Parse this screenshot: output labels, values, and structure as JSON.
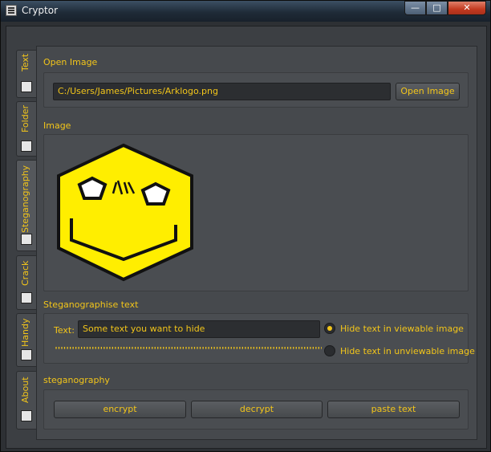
{
  "window": {
    "title": "Cryptor",
    "min_glyph": "—",
    "max_glyph": "□",
    "close_glyph": "✕"
  },
  "tabs": [
    {
      "label": "Text",
      "icon": "text-icon"
    },
    {
      "label": "Folder",
      "icon": "folder-icon"
    },
    {
      "label": "Steganography",
      "icon": "image-icon",
      "active": true
    },
    {
      "label": "Crack",
      "icon": "crack-icon"
    },
    {
      "label": "Handy",
      "icon": "calculator-icon"
    },
    {
      "label": "About",
      "icon": "about-icon"
    }
  ],
  "open_image": {
    "section_title": "Open Image",
    "path_value": "C:/Users/James/Pictures/Arklogo.png",
    "button_label": "Open Image"
  },
  "image": {
    "section_title": "Image",
    "preview": "smiley-hexagon-logo",
    "colors": {
      "face": "#ffee00",
      "outline": "#111111"
    }
  },
  "stego_text": {
    "section_title": "Steganographise text",
    "text_label": "Text:",
    "text_value": "Some text you want to hide",
    "progress_text": "''''''''''''''''''''''''''''''''''''''''''''''''''''''''''''''''''''''''''''''''''''''''''''''''''''''''''''''''''''''",
    "radio_viewable": {
      "label": "Hide text in viewable image",
      "checked": true
    },
    "radio_unviewable": {
      "label": "Hide text in unviewable image",
      "checked": false
    }
  },
  "steganography": {
    "section_title": "steganography",
    "encrypt_label": "encrypt",
    "decrypt_label": "decrypt",
    "paste_label": "paste text"
  },
  "colors": {
    "accent": "#f2c51a",
    "panel": "#46494d",
    "window": "#2d3034"
  }
}
